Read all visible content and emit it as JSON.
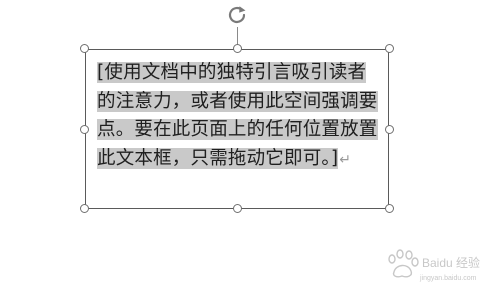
{
  "textbox": {
    "text": "[使用文档中的独特引言吸引读者的注意力，或者使用此空间强调要点。要在此页面上的任何位置放置此文本框，只需拖动它即可。]",
    "paragraph_mark": "↵",
    "selection_color": "#c9c9c9"
  },
  "icons": {
    "rotate": "rotate-handle-icon",
    "watermark": "baidu-jingyan-watermark-logo"
  },
  "watermark": {
    "text": "Baidu 经验",
    "url": "jingyan.baidu.com"
  }
}
